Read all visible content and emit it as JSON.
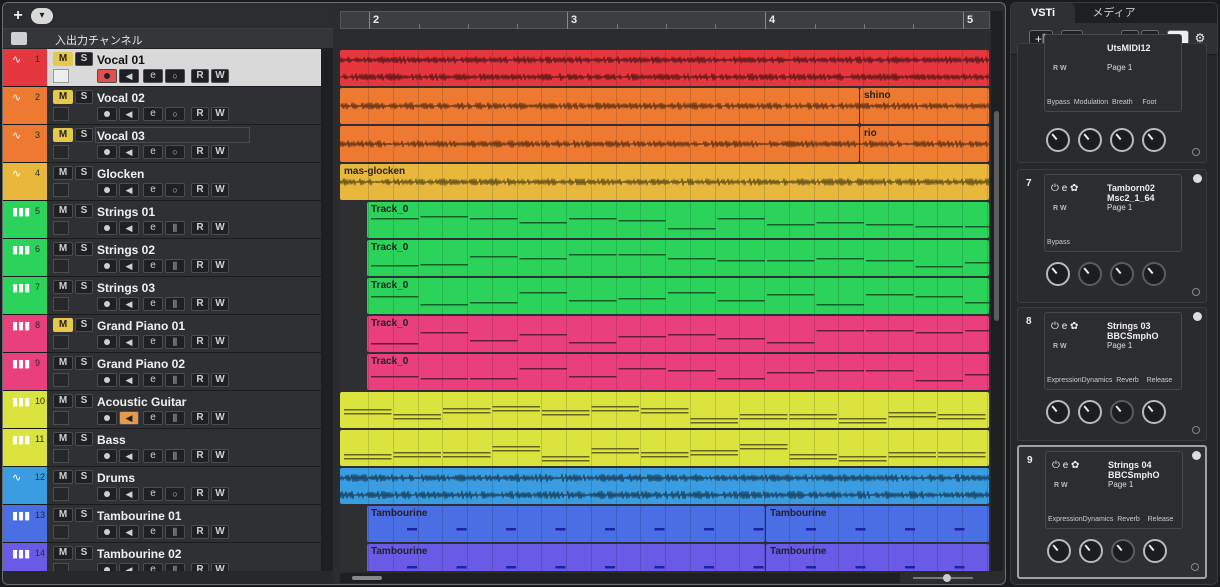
{
  "toolbar": {
    "add_icon": "+",
    "add_track_menu_icon": "▾"
  },
  "folder": {
    "label": "入出力チャンネル"
  },
  "tracks": [
    {
      "num": "1",
      "name": "Vocal 01",
      "type": "audio",
      "color": "#e5373d",
      "mute_on": true,
      "selected": true,
      "armed": true
    },
    {
      "num": "2",
      "name": "Vocal 02",
      "type": "audio",
      "color": "#ee7a31",
      "mute_on": true
    },
    {
      "num": "3",
      "name": "Vocal 03",
      "type": "audio",
      "color": "#ee7a31",
      "mute_on": true
    },
    {
      "num": "4",
      "name": "Glocken",
      "type": "audio",
      "color": "#e8b83c"
    },
    {
      "num": "5",
      "name": "Strings 01",
      "type": "instrument",
      "color": "#2bd35b"
    },
    {
      "num": "6",
      "name": "Strings 02",
      "type": "instrument",
      "color": "#2bd35b"
    },
    {
      "num": "7",
      "name": "Strings 03",
      "type": "instrument",
      "color": "#2bd35b"
    },
    {
      "num": "8",
      "name": "Grand Piano 01",
      "type": "instrument",
      "color": "#e93f7d",
      "mute_on": true
    },
    {
      "num": "9",
      "name": "Grand Piano 02",
      "type": "instrument",
      "color": "#e93f7d"
    },
    {
      "num": "10",
      "name": "Acoustic Guitar",
      "type": "instrument",
      "color": "#dbe33f",
      "monitor_on": true
    },
    {
      "num": "11",
      "name": "Bass",
      "type": "instrument",
      "color": "#dbe33f"
    },
    {
      "num": "12",
      "name": "Drums",
      "type": "audio",
      "color": "#3a9de2"
    },
    {
      "num": "13",
      "name": "Tambourine 01",
      "type": "instrument",
      "color": "#4a6ee4"
    },
    {
      "num": "14",
      "name": "Tambourine 02",
      "type": "instrument",
      "color": "#6a5be6"
    }
  ],
  "labels": {
    "mute": "M",
    "solo": "S",
    "read": "R",
    "write": "W",
    "edit": "e"
  },
  "ruler": {
    "bars": [
      "2",
      "3",
      "4",
      "5"
    ]
  },
  "events": [
    {
      "lane": 0,
      "parts": [
        {
          "start": 0,
          "end": 1,
          "label": ""
        }
      ],
      "color": "#e5373d"
    },
    {
      "lane": 1,
      "parts": [
        {
          "start": 0,
          "end": 0.8,
          "label": ""
        },
        {
          "start": 0.8,
          "end": 1,
          "label": "shino"
        }
      ],
      "color": "#ee7a31"
    },
    {
      "lane": 2,
      "parts": [
        {
          "start": 0,
          "end": 0.8,
          "label": ""
        },
        {
          "start": 0.8,
          "end": 1,
          "label": "rio"
        }
      ],
      "color": "#ee7a31"
    },
    {
      "lane": 3,
      "parts": [
        {
          "start": 0,
          "end": 1,
          "label": "mas-glocken"
        }
      ],
      "color": "#e8b83c"
    },
    {
      "lane": 4,
      "parts": [
        {
          "start": 0.042,
          "end": 1,
          "label": "Track_0"
        }
      ],
      "color": "#2bd35b"
    },
    {
      "lane": 5,
      "parts": [
        {
          "start": 0.042,
          "end": 1,
          "label": "Track_0"
        }
      ],
      "color": "#2bd35b"
    },
    {
      "lane": 6,
      "parts": [
        {
          "start": 0.042,
          "end": 1,
          "label": "Track_0"
        }
      ],
      "color": "#2bd35b"
    },
    {
      "lane": 7,
      "parts": [
        {
          "start": 0.042,
          "end": 1,
          "label": "Track_0"
        }
      ],
      "color": "#e93f7d"
    },
    {
      "lane": 8,
      "parts": [
        {
          "start": 0.042,
          "end": 1,
          "label": "Track_0"
        }
      ],
      "color": "#e93f7d"
    },
    {
      "lane": 9,
      "parts": [
        {
          "start": 0,
          "end": 1,
          "label": ""
        }
      ],
      "color": "#dbe33f"
    },
    {
      "lane": 10,
      "parts": [
        {
          "start": 0,
          "end": 1,
          "label": ""
        }
      ],
      "color": "#dbe33f"
    },
    {
      "lane": 11,
      "parts": [
        {
          "start": 0,
          "end": 1,
          "label": ""
        }
      ],
      "color": "#3a9de2"
    },
    {
      "lane": 12,
      "parts": [
        {
          "start": 0.042,
          "end": 0.655,
          "label": "Tambourine"
        },
        {
          "start": 0.655,
          "end": 1,
          "label": "Tambourine"
        }
      ],
      "color": "#4a6ee4"
    },
    {
      "lane": 13,
      "parts": [
        {
          "start": 0.042,
          "end": 0.655,
          "label": "Tambourine"
        },
        {
          "start": 0.655,
          "end": 1,
          "label": "Tambourine"
        }
      ],
      "color": "#6a5be6"
    }
  ],
  "rack": {
    "tabs": [
      "VSTi",
      "メディア"
    ],
    "slots": [
      {
        "num": "",
        "name": "UtsMIDI12",
        "page": "Page 1",
        "params": "Bypass  Modulation  Breath     Foot",
        "knob_style": [
          "on",
          "on",
          "on",
          "on"
        ]
      },
      {
        "num": "7",
        "name": "Tamborn02\nMsc2_1_64",
        "page": "Page 1",
        "params": "Bypass",
        "knob_style": [
          "on",
          "dim",
          "dim",
          "dim"
        ]
      },
      {
        "num": "8",
        "name": "Strings 03\nBBCSmphO",
        "page": "Page 1",
        "params": "ExpressionDynamics  Reverb    Release",
        "knob_style": [
          "on",
          "on",
          "dim",
          "on"
        ]
      },
      {
        "num": "9",
        "name": "Strings 04\nBBCSmphO",
        "page": "Page 1",
        "params": "ExpressionDynamics  Reverb    Release",
        "knob_style": [
          "on",
          "on",
          "dim",
          "on"
        ],
        "selected": true
      }
    ]
  }
}
